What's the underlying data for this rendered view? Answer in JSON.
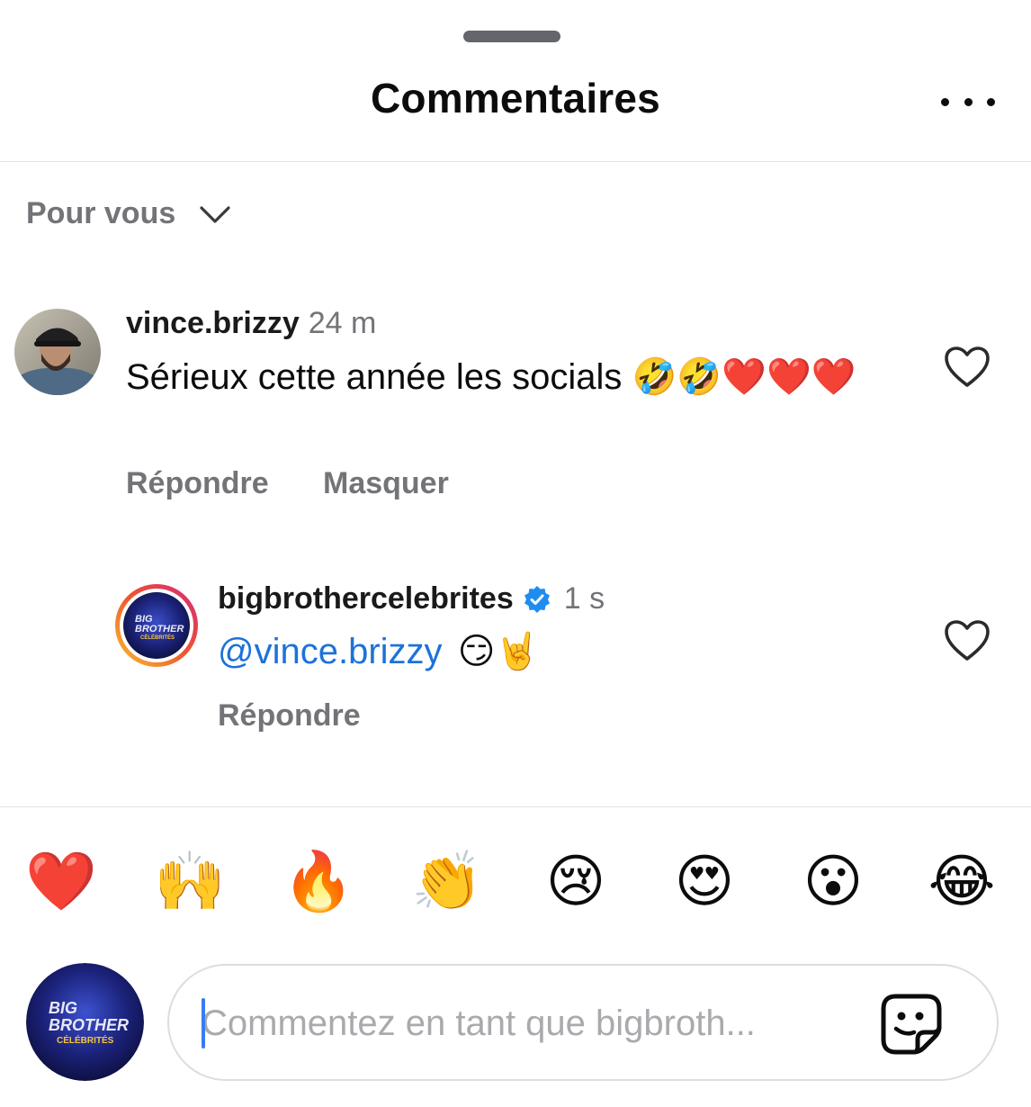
{
  "header": {
    "title": "Commentaires",
    "more_icon": "more-horizontal-icon"
  },
  "sort": {
    "label": "Pour vous",
    "icon": "chevron-down-icon"
  },
  "comments": [
    {
      "username": "vince.brizzy",
      "time": "24 m",
      "text": "Sérieux cette année les socials 🤣🤣❤️❤️❤️",
      "actions": [
        "Répondre",
        "Masquer"
      ],
      "avatar": "user-photo"
    },
    {
      "username": "bigbrothercelebrites",
      "verified": true,
      "time": "1 s",
      "mention": "@vince.brizzy",
      "text": "😏🤘",
      "actions": [
        "Répondre"
      ],
      "avatar_logo": [
        "BIG",
        "BROTHER",
        "CÉLÉBRITÉS"
      ]
    }
  ],
  "quick_reactions": [
    "❤️",
    "🙌",
    "🔥",
    "👏",
    "😢",
    "😍",
    "😮",
    "😂"
  ],
  "composer": {
    "placeholder": "Commentez en tant que bigbroth...",
    "sticker_icon": "sticker-icon",
    "avatar_logo": [
      "BIG",
      "BROTHER",
      "CÉLÉBRITÉS"
    ]
  },
  "colors": {
    "mention": "#1d72d9",
    "verified": "#1f8cf0",
    "muted": "#737478",
    "story_ring_start": "#f9c22e",
    "story_ring_end": "#d3277d"
  }
}
